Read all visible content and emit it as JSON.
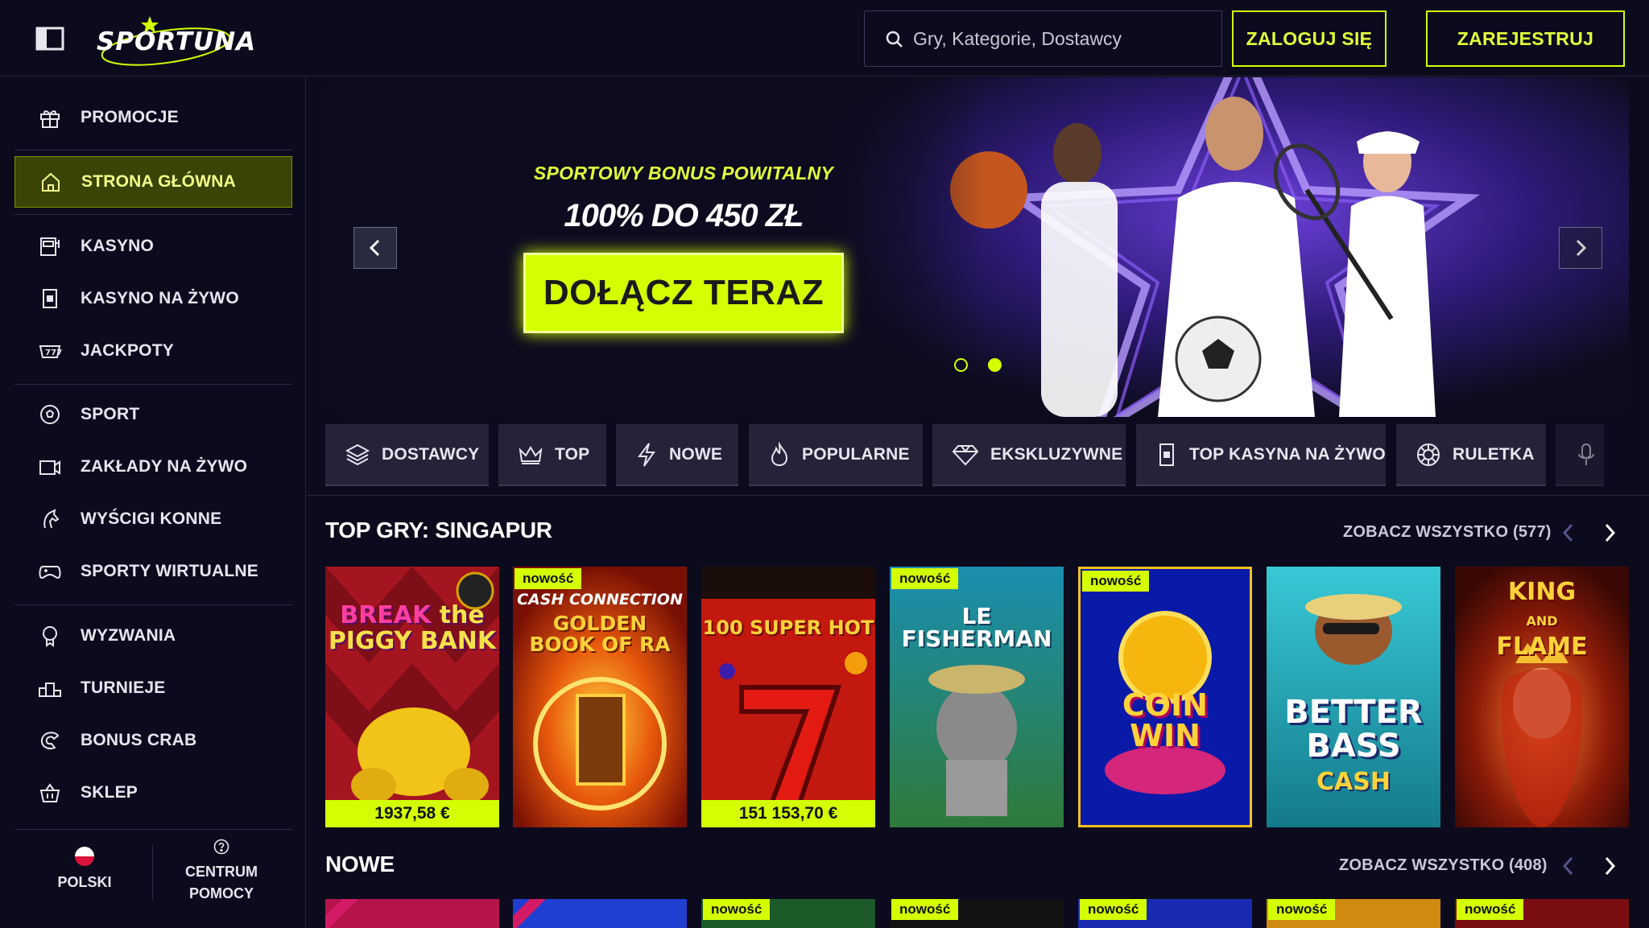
{
  "header": {
    "logo_text": "SPORTUNA",
    "search_placeholder": "Gry, Kategorie, Dostawcy",
    "login_label": "ZALOGUJ SIĘ",
    "register_label": "ZAREJESTRUJ"
  },
  "sidebar": {
    "items": [
      {
        "label": "PROMOCJE",
        "icon": "gift-icon"
      },
      {
        "label": "STRONA GŁÓWNA",
        "icon": "home-icon",
        "active": true
      },
      {
        "label": "KASYNO",
        "icon": "slot-machine-icon"
      },
      {
        "label": "KASYNO NA ŻYWO",
        "icon": "playing-card-icon"
      },
      {
        "label": "JACKPOTY",
        "icon": "jackpot-icon"
      },
      {
        "label": "SPORT",
        "icon": "soccer-ball-icon"
      },
      {
        "label": "ZAKŁADY NA ŻYWO",
        "icon": "live-camera-icon"
      },
      {
        "label": "WYŚCIGI KONNE",
        "icon": "horse-icon"
      },
      {
        "label": "SPORTY WIRTUALNE",
        "icon": "gamepad-icon"
      },
      {
        "label": "WYZWANIA",
        "icon": "badge-icon"
      },
      {
        "label": "TURNIEJE",
        "icon": "podium-icon"
      },
      {
        "label": "BONUS CRAB",
        "icon": "crab-claw-icon"
      },
      {
        "label": "SKLEP",
        "icon": "shop-basket-icon"
      }
    ],
    "language_label": "POLSKI",
    "help_label_line1": "CENTRUM",
    "help_label_line2": "POMOCY"
  },
  "banner": {
    "subtitle": "SPORTOWY BONUS POWITALNY",
    "title": "100% DO 450 ZŁ",
    "cta_label": "DOŁĄCZ TERAZ",
    "slides_total": 2,
    "active_slide": 2
  },
  "tabs": [
    {
      "label": "DOSTAWCY",
      "icon": "layers-icon"
    },
    {
      "label": "TOP",
      "icon": "crown-icon"
    },
    {
      "label": "NOWE",
      "icon": "lightning-icon"
    },
    {
      "label": "POPULARNE",
      "icon": "flame-icon"
    },
    {
      "label": "EKSKLUZYWNE",
      "icon": "diamond-icon"
    },
    {
      "label": "TOP KASYNA NA ŻYWO",
      "icon": "card-icon"
    },
    {
      "label": "RULETKA",
      "icon": "roulette-icon"
    },
    {
      "label": "",
      "icon": "microphone-icon"
    }
  ],
  "sections": {
    "top": {
      "title": "TOP GRY: SINGAPUR",
      "see_all": "ZOBACZ WSZYSTKO (577)",
      "games": [
        {
          "name": "BREAK the PIGGY BANK",
          "badge": "",
          "jackpot": "1937,58 €"
        },
        {
          "name": "CASH CONNECTION GOLDEN BOOK OF RA",
          "badge": "nowość",
          "jackpot": ""
        },
        {
          "name": "100 SUPER HOT",
          "badge": "",
          "jackpot": "151 153,70 €"
        },
        {
          "name": "LE FISHERMAN",
          "badge": "nowość",
          "jackpot": ""
        },
        {
          "name": "COIN WIN",
          "badge": "nowość",
          "jackpot": ""
        },
        {
          "name": "BETTER BASS CASH",
          "badge": "",
          "jackpot": ""
        },
        {
          "name": "KING AND FLAME",
          "badge": "",
          "jackpot": ""
        }
      ]
    },
    "new": {
      "title": "NOWE",
      "see_all": "ZOBACZ WSZYSTKO (408)",
      "badges": [
        "",
        "",
        "nowość",
        "nowość",
        "nowość",
        "nowość",
        "nowość"
      ]
    }
  },
  "colors": {
    "accent": "#d4ff00",
    "background": "#0c0b1d",
    "tab_bg": "#24233a"
  }
}
